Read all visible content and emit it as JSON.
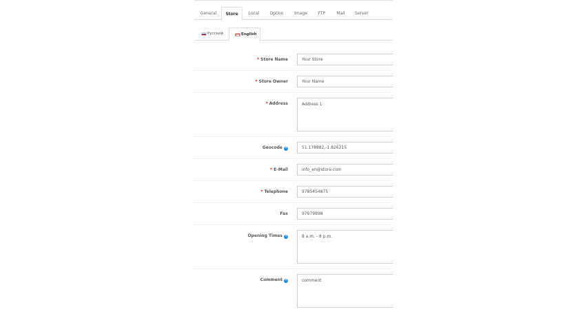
{
  "tabs": [
    "General",
    "Store",
    "Local",
    "Option",
    "Image",
    "FTP",
    "Mail",
    "Server"
  ],
  "active_tab": "Store",
  "languages": [
    {
      "label": "Русский",
      "flag": "ru-flag-icon"
    },
    {
      "label": "English",
      "flag": "gb-flag-icon"
    }
  ],
  "active_language": "English",
  "form": {
    "store_name": {
      "label": "Store Name",
      "required": true,
      "value": "Your Store"
    },
    "store_owner": {
      "label": "Store Owner",
      "required": true,
      "value": "Your Name"
    },
    "address": {
      "label": "Address",
      "required": true,
      "value": "Address 1"
    },
    "geocode": {
      "label": "Geocode",
      "help": true,
      "value": "51.178882,-1.826215"
    },
    "email": {
      "label": "E-Mail",
      "required": true,
      "value": "info_en@store.com"
    },
    "telephone": {
      "label": "Telephone",
      "required": true,
      "value": "9785454875"
    },
    "fax": {
      "label": "Fax",
      "value": "97979898"
    },
    "opening_times": {
      "label": "Opening Times",
      "help": true,
      "value": "8 a.m. - 8 p.m."
    },
    "comment": {
      "label": "Comment",
      "help": true,
      "value": "comment"
    }
  },
  "colors": {
    "required": "#c5311f",
    "help": "#2a8ad8",
    "border": "#cccccc"
  }
}
